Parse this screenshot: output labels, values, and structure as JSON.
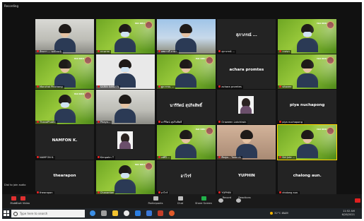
{
  "window": {
    "recording_label": "Recording"
  },
  "banner_text": "ISO KRU",
  "tiles": [
    {
      "name": "อัจฉรา ... นงลักษณ์",
      "style": "room",
      "face": true,
      "mask": false
    },
    {
      "name": "กรวภาพ",
      "style": "green",
      "face": true,
      "mask": true
    },
    {
      "name": "อทยาวดี  ภาษา",
      "style": "sky",
      "face": true,
      "mask": false
    },
    {
      "name": "สุภาภรณ์ ...",
      "style": "dark",
      "center": "สุภาภรณ์ ...",
      "face": false
    },
    {
      "name": "วาสนา",
      "style": "green",
      "face": true,
      "mask": true
    },
    {
      "name": "Monchai Pinkhong",
      "style": "green",
      "face": true,
      "mask": false
    },
    {
      "name": "SARIN INMUEN",
      "style": "white",
      "face": true,
      "mask": true
    },
    {
      "name": "ศูภวรรณ ...",
      "style": "green",
      "face": true,
      "mask": false
    },
    {
      "name": "achara promtes",
      "style": "dark",
      "center": "achara promtes",
      "face": false
    },
    {
      "name": "vitavee",
      "style": "green",
      "face": true,
      "mask": false
    },
    {
      "name": "ThanaPhathi",
      "style": "green",
      "face": true,
      "mask": true
    },
    {
      "name": "Phayo...",
      "style": "room",
      "face": true,
      "mask": false
    },
    {
      "name": "นารีรัตน์ สุปกิจสิทธิ์",
      "style": "dark",
      "center": "นารีรัตน์ สุปกิจสิทธิ์",
      "face": false
    },
    {
      "name": "Oraween Lakchiwin",
      "style": "dark",
      "face": false,
      "pic": true
    },
    {
      "name": "piya nuchapong",
      "style": "dark",
      "center": "piya nuchapong",
      "face": false
    },
    {
      "name": "NAMFON K.",
      "style": "dark",
      "center": "NAMFON K.",
      "face": false
    },
    {
      "name": "Kimpahn T",
      "style": "dark",
      "face": false,
      "pic": true
    },
    {
      "name": "เกศินี ...",
      "style": "green",
      "face": true,
      "mask": false
    },
    {
      "name": "ศิลปุณ - Tuvenin",
      "style": "peach",
      "face": true,
      "mask": false
    },
    {
      "name": "Siri Jule ...",
      "style": "green",
      "face": true,
      "mask": false,
      "active": true
    },
    {
      "name": "thearapon",
      "style": "dark",
      "center": "thearapon",
      "face": false
    },
    {
      "name": "Chanantan",
      "style": "green",
      "face": true,
      "mask": true
    },
    {
      "name": "อาไรร์",
      "style": "dark",
      "center": "อาไรร์",
      "face": false
    },
    {
      "name": "YUPHIN",
      "style": "dark",
      "center": "YUPHIN",
      "face": false
    },
    {
      "name": "chalong aun.",
      "style": "dark",
      "center": "chalong aun.",
      "face": false
    }
  ],
  "dial_in": "Dial to join audio",
  "toolbar": {
    "mute": "Mute",
    "video": "Start Video",
    "participants": "Participants",
    "participants_count": "25",
    "chat": "Chat",
    "share": "Share Screen",
    "record": "Record",
    "reactions": "Reactions"
  },
  "taskbar": {
    "search_placeholder": "Type here to search",
    "weather": "32°C ฝนตก",
    "time": "11:52 AM",
    "date": "6/28/2021"
  },
  "colors": {
    "zoom_green": "#21b14a",
    "mute_red": "#e03030",
    "active_speaker": "#ffd400"
  }
}
